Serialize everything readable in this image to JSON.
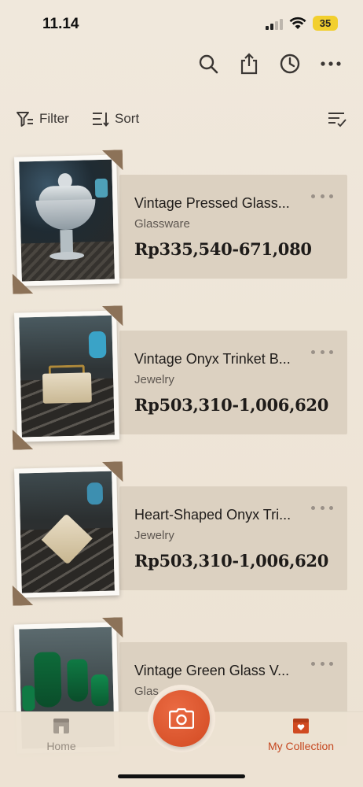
{
  "status_bar": {
    "time": "11.14",
    "battery": "35",
    "battery_color": "#f2cf2e"
  },
  "toolbar": {
    "icons": [
      "search-icon",
      "share-icon",
      "history-icon",
      "more-icon"
    ]
  },
  "filter_bar": {
    "filter_label": "Filter",
    "sort_label": "Sort",
    "list_icon": "list-check-icon"
  },
  "items": [
    {
      "title": "Vintage Pressed Glass...",
      "category": "Glassware",
      "price": "Rp335,540-671,080"
    },
    {
      "title": "Vintage Onyx Trinket B...",
      "category": "Jewelry",
      "price": "Rp503,310-1,006,620"
    },
    {
      "title": "Heart-Shaped Onyx Tri...",
      "category": "Jewelry",
      "price": "Rp503,310-1,006,620"
    },
    {
      "title": "Vintage Green Glass V...",
      "category": "Glas"
    }
  ],
  "tab_bar": {
    "home_label": "Home",
    "collection_label": "My Collection",
    "accent": "#d04a21"
  }
}
